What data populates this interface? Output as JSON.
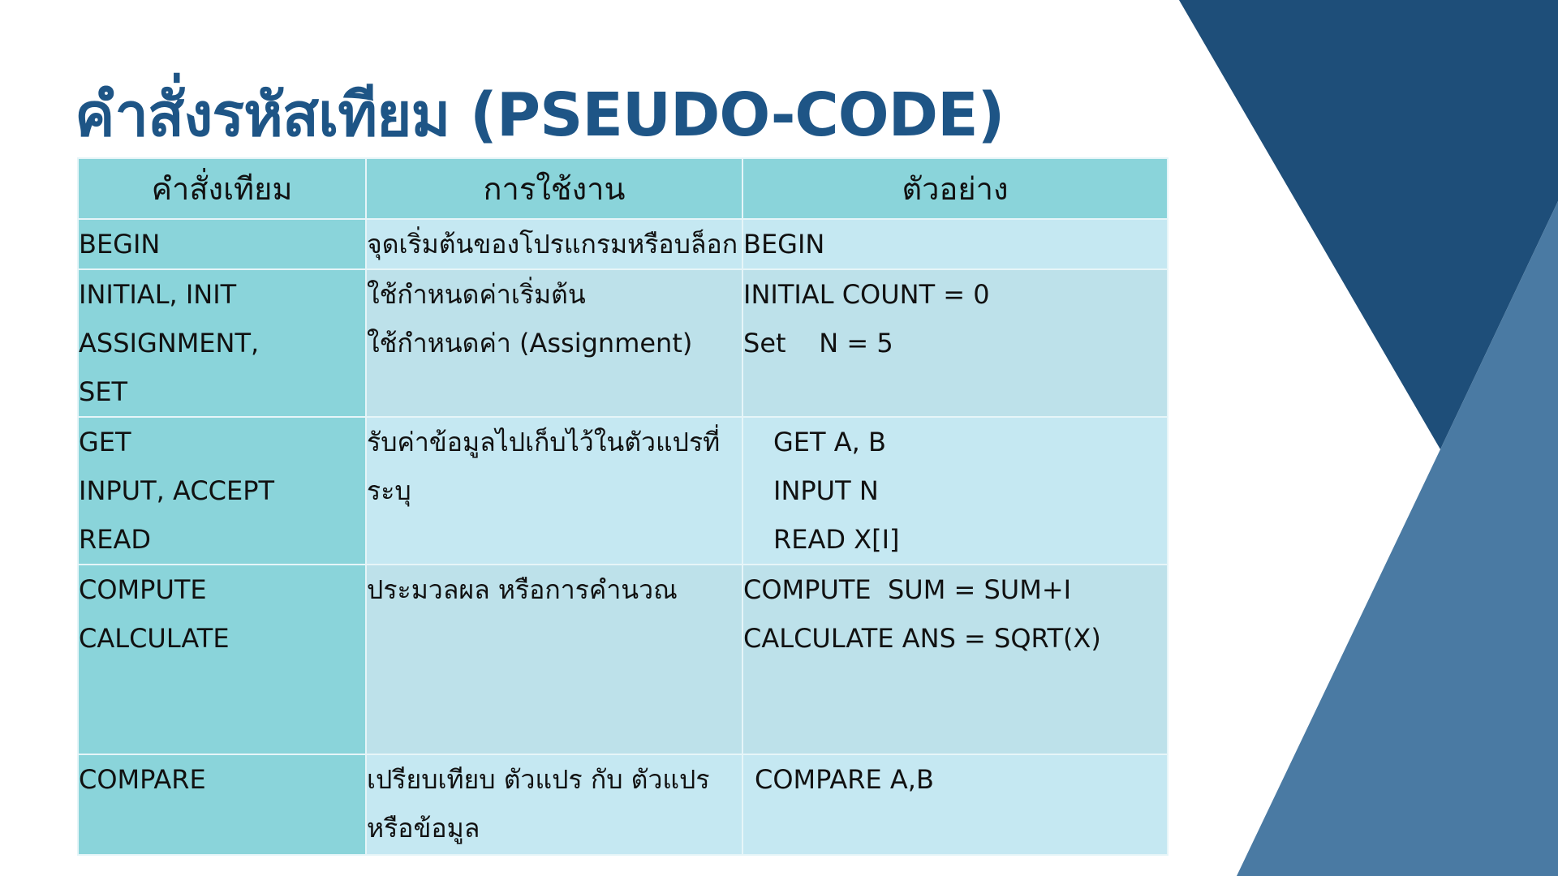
{
  "title": "คำสั่งรหัสเทียม (PSEUDO-CODE)",
  "colors": {
    "title": "#1e5586",
    "header_bg": "#8ad4da",
    "cell_bg": "#c5e8f2",
    "shape_dark": "#1e4e79",
    "shape_light": "#4a7aa3"
  },
  "table": {
    "headers": [
      "คำสั่งเทียม",
      "การใช้งาน",
      "ตัวอย่าง"
    ],
    "rows": [
      {
        "commands": [
          "BEGIN"
        ],
        "usage": [
          "จุดเริ่มต้นของโปรแกรมหรือบล็อก"
        ],
        "examples": [
          "BEGIN"
        ]
      },
      {
        "commands": [
          "INITIAL, INIT",
          "ASSIGNMENT,",
          "SET"
        ],
        "usage": [
          "ใช้กำหนดค่าเริ่มต้น",
          "ใช้กำหนดค่า (Assignment)"
        ],
        "examples": [
          "INITIAL COUNT = 0",
          "Set    N = 5"
        ]
      },
      {
        "commands": [
          "GET",
          "INPUT, ACCEPT",
          "READ"
        ],
        "usage": [
          "รับค่าข้อมูลไปเก็บไว้ในตัวแปรที่",
          "ระบุ"
        ],
        "examples": [
          "GET A, B",
          "INPUT N",
          "READ X[I]"
        ]
      },
      {
        "commands": [
          "COMPUTE",
          "CALCULATE"
        ],
        "usage": [
          "ประมวลผล หรือการคำนวณ"
        ],
        "examples": [
          "COMPUTE  SUM = SUM+I",
          "CALCULATE ANS = SQRT(X)"
        ]
      },
      {
        "commands": [
          "COMPARE"
        ],
        "usage": [
          "เปรียบเทียบ ตัวแปร กับ ตัวแปร",
          "หรือข้อมูล"
        ],
        "examples": [
          "COMPARE A,B"
        ]
      }
    ]
  }
}
